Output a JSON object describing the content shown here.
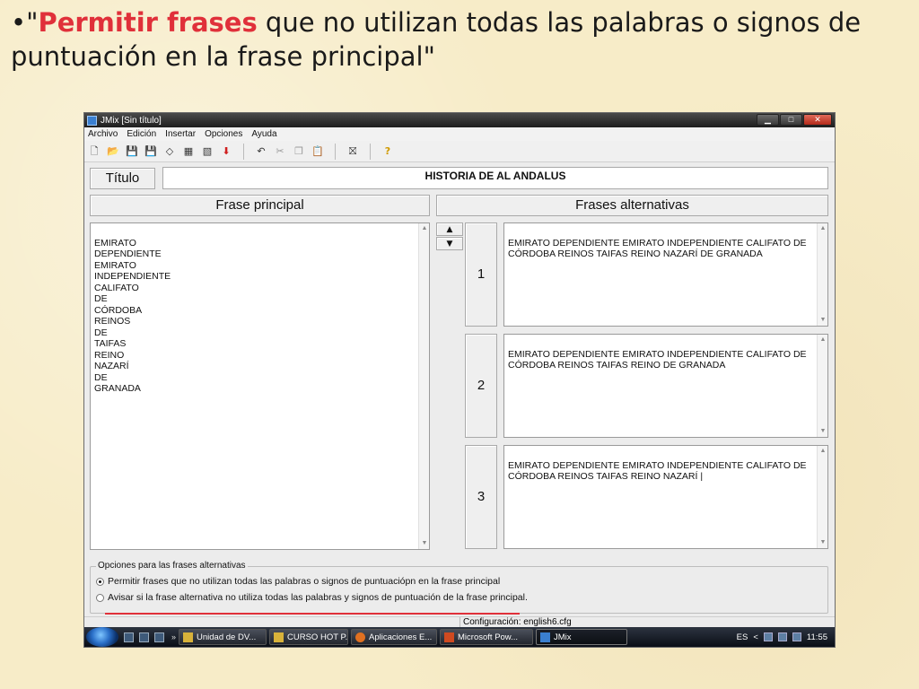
{
  "slide": {
    "bullet": "•",
    "quote_open": "\"",
    "title_highlight": "Permitir frases",
    "title_rest": " que no utilizan todas las palabras o signos de puntuación en la frase principal",
    "quote_close": "\"",
    "highlight_color": "#e0303a"
  },
  "window": {
    "title": "JMix [Sin título]",
    "controls": {
      "minimize": "▁",
      "maximize": "□",
      "close": "✕"
    }
  },
  "menu": [
    "Archivo",
    "Edición",
    "Insertar",
    "Opciones",
    "Ayuda"
  ],
  "toolbar": {
    "icons": [
      "new-icon",
      "open-icon",
      "save-icon",
      "save-as-icon",
      "eraser-icon",
      "grid-icon",
      "grid-export-icon",
      "arrow-down-red-icon",
      "undo-icon",
      "cut-icon",
      "copy-icon",
      "paste-icon",
      "web-export-icon",
      "help-icon"
    ],
    "glyphs": {
      "new": "🗋",
      "open": "📂",
      "save": "💾",
      "save_as": "💾",
      "eraser": "◇",
      "grid": "▦",
      "grid_export": "▧",
      "arrow_down": "⬇",
      "undo": "↶",
      "cut": "✂",
      "copy": "❐",
      "paste": "📋",
      "web_export": "⛝",
      "help": "?"
    }
  },
  "form": {
    "titulo_label": "Título",
    "titulo_value": "HISTORIA DE AL ANDALUS",
    "main_header": "Frase principal",
    "alt_header": "Frases alternativas",
    "main_text": "EMIRATO\nDEPENDIENTE\nEMIRATO\nINDEPENDIENTE\nCALIFATO\nDE\nCÓRDOBA\nREINOS\nDE\nTAIFAS\nREINO\nNAZARÍ\nDE\nGRANADA",
    "arrow_up": "▲",
    "arrow_down": "▼",
    "alternatives": [
      {
        "number": "1",
        "text": "EMIRATO DEPENDIENTE EMIRATO INDEPENDIENTE CALIFATO DE CÓRDOBA REINOS TAIFAS REINO NAZARÍ DE GRANADA"
      },
      {
        "number": "2",
        "text": "EMIRATO DEPENDIENTE EMIRATO INDEPENDIENTE CALIFATO DE CÓRDOBA REINOS TAIFAS REINO DE GRANADA"
      },
      {
        "number": "3",
        "text": "EMIRATO DEPENDIENTE EMIRATO INDEPENDIENTE CALIFATO DE CÓRDOBA REINOS TAIFAS REINO NAZARÍ |"
      }
    ]
  },
  "options": {
    "legend": "Opciones para las frases alternativas",
    "option1": "Permitir frases que no utilizan todas las palabras o signos de puntuaciópn en la frase principal",
    "option1_selected": true,
    "option2": "Avisar si la frase alternativa no utiliza todas las palabras y signos de puntuación de la frase principal.",
    "option2_selected": false
  },
  "status": {
    "config": "Configuración: english6.cfg"
  },
  "taskbar": {
    "chevron": "»",
    "tasks": [
      {
        "label": "Unidad de DV...",
        "icon_color": "#d8b23a"
      },
      {
        "label": "CURSO HOT P...",
        "icon_color": "#d8b23a"
      },
      {
        "label": "Aplicaciones E...",
        "icon_color": "#e07020"
      },
      {
        "label": "Microsoft Pow...",
        "icon_color": "#d04a20"
      },
      {
        "label": "JMix",
        "icon_color": "#3a7fd0"
      }
    ],
    "lang": "ES",
    "tray_arrow": "<",
    "clock": "11:55"
  }
}
